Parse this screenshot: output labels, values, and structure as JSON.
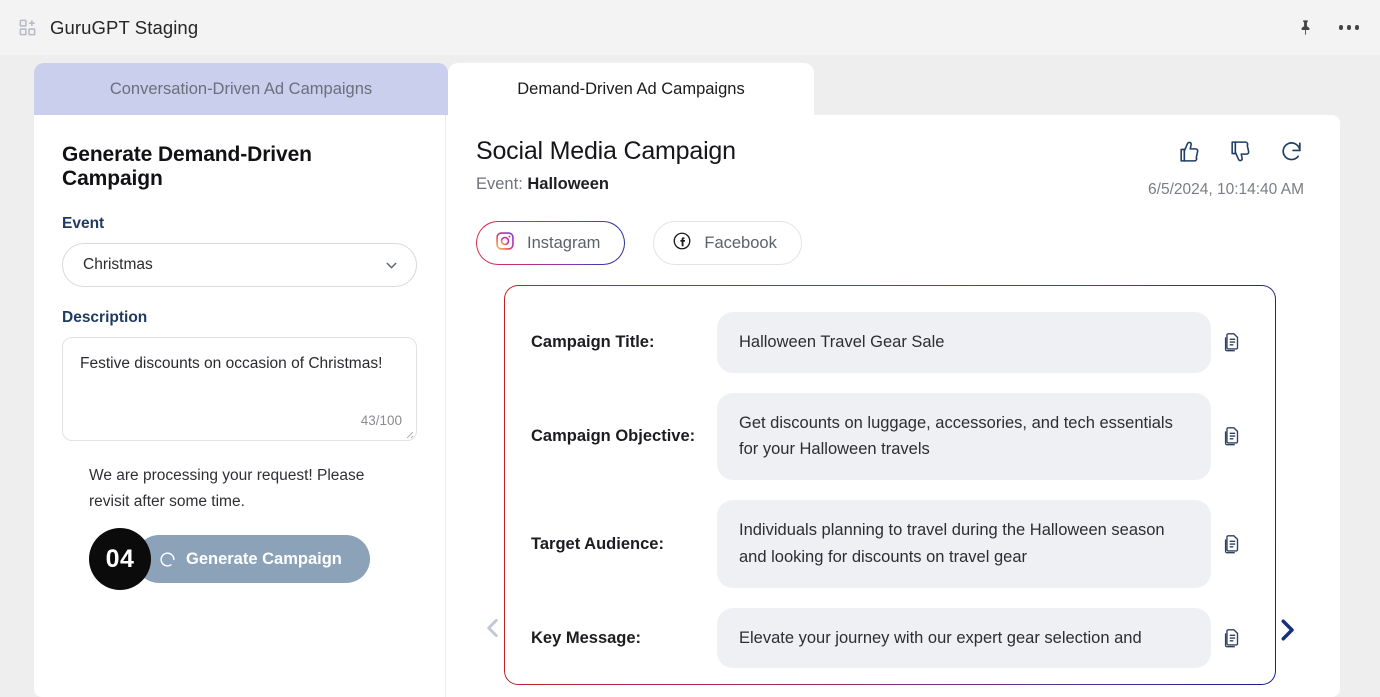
{
  "appbar": {
    "logo_icon": "apps-add-icon",
    "title": "GuruGPT Staging",
    "pin_icon": "pin-icon",
    "more_icon": "more-options-icon"
  },
  "tabs": [
    {
      "label": "Conversation-Driven Ad Campaigns",
      "active": false
    },
    {
      "label": "Demand-Driven Ad Campaigns",
      "active": true
    }
  ],
  "form": {
    "heading": "Generate Demand-Driven Campaign",
    "event_label": "Event",
    "event_value": "Christmas",
    "event_chevron_icon": "chevron-down-icon",
    "description_label": "Description",
    "description_value": "Festive discounts on occasion of Christmas!",
    "description_placeholder": "Description",
    "char_count": "43/100",
    "resize_icon": "resize-grip-icon",
    "status_message": "We are processing your request! Please revisit after some time.",
    "countdown": "04",
    "generate_label": "Generate Campaign",
    "spinner_icon": "loading-spinner-icon"
  },
  "result": {
    "title": "Social Media Campaign",
    "event_prefix": "Event:",
    "event_name": "Halloween",
    "timestamp": "6/5/2024, 10:14:40 AM",
    "thumbs_up_icon": "thumbs-up-icon",
    "thumbs_down_icon": "thumbs-down-icon",
    "regenerate_icon": "refresh-icon",
    "platforms": [
      {
        "label": "Instagram",
        "icon": "instagram-icon",
        "selected": true
      },
      {
        "label": "Facebook",
        "icon": "facebook-icon",
        "selected": false
      }
    ],
    "prev_icon": "chevron-left-icon",
    "next_icon": "chevron-right-icon",
    "copy_icon": "copy-icon",
    "rows": [
      {
        "label": "Campaign Title:",
        "value": "Halloween Travel Gear Sale"
      },
      {
        "label": "Campaign Objective:",
        "value": "Get discounts on luggage, accessories, and tech essentials for your Halloween travels"
      },
      {
        "label": "Target Audience:",
        "value": "Individuals planning to travel during the Halloween season and looking for discounts on travel gear"
      },
      {
        "label": "Key Message:",
        "value": "Elevate your journey with our expert gear selection and"
      }
    ]
  },
  "colors": {
    "accent_blue": "#15307d",
    "accent_red": "#c02222",
    "tab_inactive_bg": "#c9cfec",
    "button_disabled": "#8ba2b9",
    "field_label": "#1f3a5f"
  }
}
